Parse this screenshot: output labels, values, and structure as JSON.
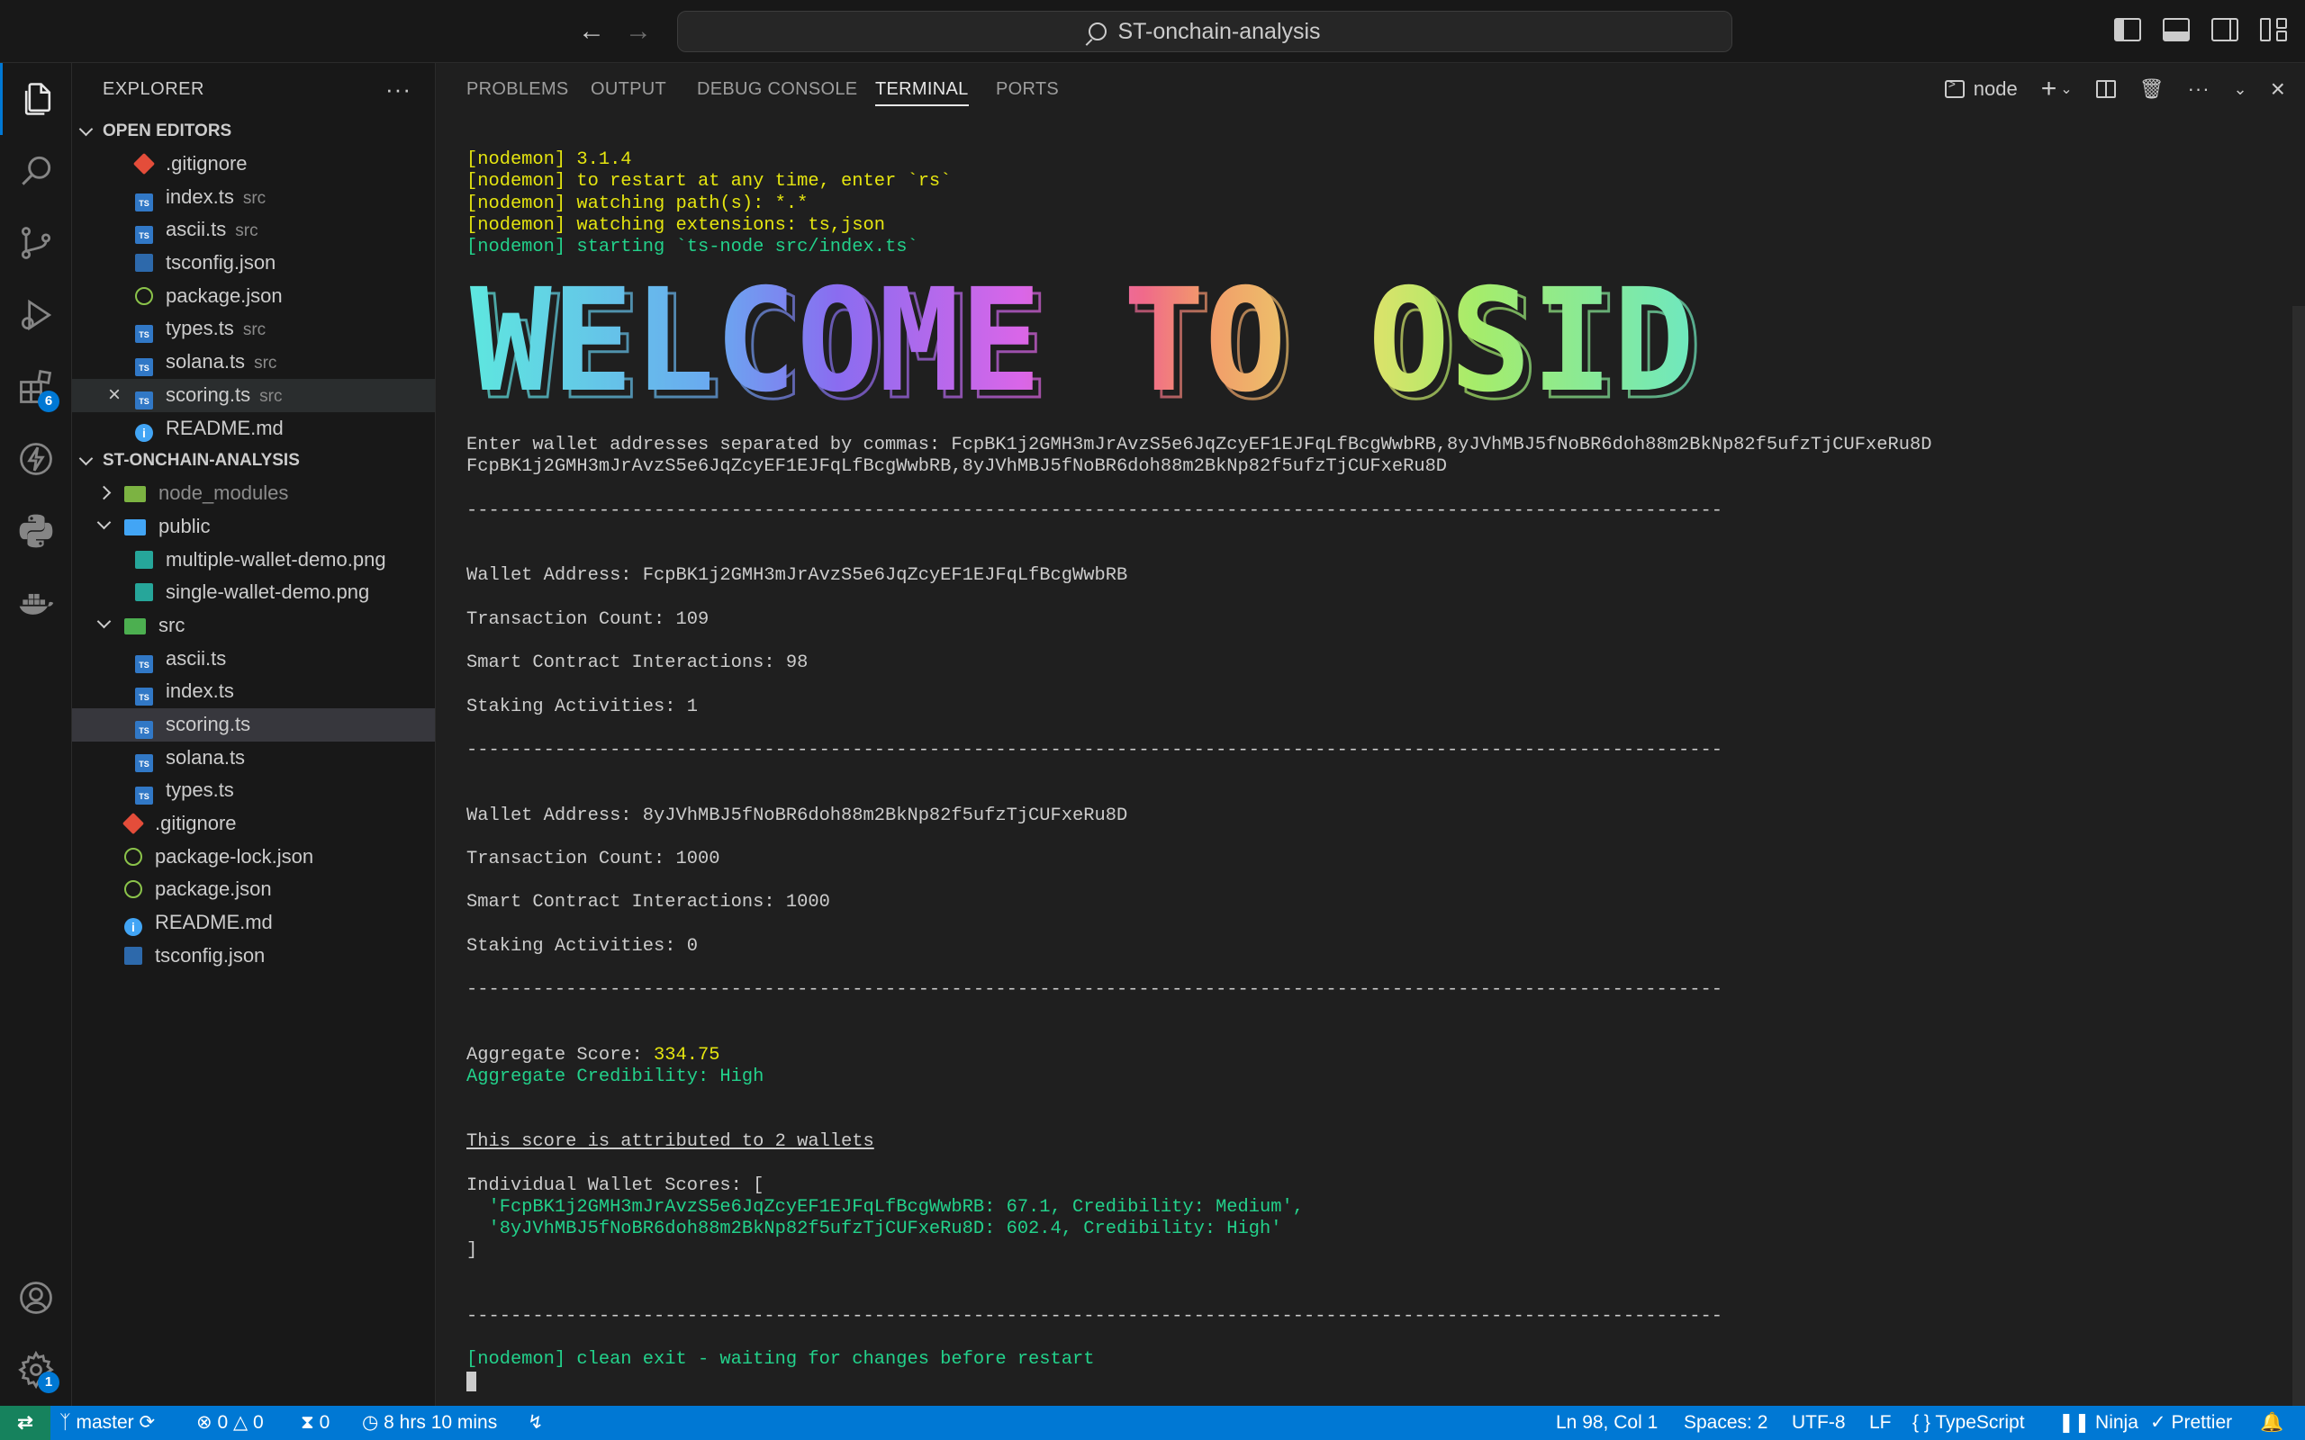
{
  "titlebar": {
    "search_text": "ST-onchain-analysis",
    "back_icon": "arrow-left-icon",
    "forward_icon": "arrow-right-icon"
  },
  "activitybar": {
    "extensions_badge": "6",
    "settings_badge": "1"
  },
  "explorer": {
    "title": "EXPLORER",
    "open_editors_label": "OPEN EDITORS",
    "open_editors": [
      {
        "name": ".gitignore",
        "desc": ""
      },
      {
        "name": "index.ts",
        "desc": "src"
      },
      {
        "name": "ascii.ts",
        "desc": "src"
      },
      {
        "name": "tsconfig.json",
        "desc": ""
      },
      {
        "name": "package.json",
        "desc": ""
      },
      {
        "name": "types.ts",
        "desc": "src"
      },
      {
        "name": "solana.ts",
        "desc": "src"
      },
      {
        "name": "scoring.ts",
        "desc": "src"
      },
      {
        "name": "README.md",
        "desc": ""
      }
    ],
    "project_label": "ST-ONCHAIN-ANALYSIS",
    "tree": {
      "node_modules": "node_modules",
      "public": "public",
      "public_files": [
        "multiple-wallet-demo.png",
        "single-wallet-demo.png"
      ],
      "src": "src",
      "src_files": [
        "ascii.ts",
        "index.ts",
        "scoring.ts",
        "solana.ts",
        "types.ts"
      ],
      "root_files": [
        ".gitignore",
        "package-lock.json",
        "package.json",
        "README.md",
        "tsconfig.json"
      ]
    }
  },
  "panel": {
    "tabs": [
      "PROBLEMS",
      "OUTPUT",
      "DEBUG CONSOLE",
      "TERMINAL",
      "PORTS"
    ],
    "terminal_name": "node"
  },
  "terminal": {
    "nodemon": [
      "[nodemon] 3.1.4",
      "[nodemon] to restart at any time, enter `rs`",
      "[nodemon] watching path(s): *.*",
      "[nodemon] watching extensions: ts,json"
    ],
    "nodemon_start": "[nodemon] starting `ts-node src/index.ts`",
    "banner_text": "WELCOME TO OSID",
    "prompt": "Enter wallet addresses separated by commas: FcpBK1j2GMH3mJrAvzS5e6JqZcyEF1EJFqLfBcgWwbRB,8yJVhMBJ5fNoBR6doh88m2BkNp82f5ufzTjCUFxeRu8D",
    "echo": "FcpBK1j2GMH3mJrAvzS5e6JqZcyEF1EJFqLfBcgWwbRB,8yJVhMBJ5fNoBR6doh88m2BkNp82f5ufzTjCUFxeRu8D",
    "divider": "------------------------------------------------------------------------------------------------------------------",
    "wallets": [
      {
        "address_line": "Wallet Address: FcpBK1j2GMH3mJrAvzS5e6JqZcyEF1EJFqLfBcgWwbRB",
        "tx_line": "Transaction Count: 109",
        "sc_line": "Smart Contract Interactions: 98",
        "stake_line": "Staking Activities: 1"
      },
      {
        "address_line": "Wallet Address: 8yJVhMBJ5fNoBR6doh88m2BkNp82f5ufzTjCUFxeRu8D",
        "tx_line": "Transaction Count: 1000",
        "sc_line": "Smart Contract Interactions: 1000",
        "stake_line": "Staking Activities: 0"
      }
    ],
    "aggregate_label": "Aggregate Score: ",
    "aggregate_value": "334.75",
    "credibility_line": "Aggregate Credibility: High",
    "attributed_line": "This score is attributed to 2 wallets",
    "individual_open": "Individual Wallet Scores: [",
    "individual_scores": [
      "  'FcpBK1j2GMH3mJrAvzS5e6JqZcyEF1EJFqLfBcgWwbRB: 67.1, Credibility: Medium',",
      "  '8yJVhMBJ5fNoBR6doh88m2BkNp82f5ufzTjCUFxeRu8D: 602.4, Credibility: High'"
    ],
    "individual_close": "]",
    "exit_line": "[nodemon] clean exit - waiting for changes before restart"
  },
  "statusbar": {
    "branch": "master",
    "errors": "0",
    "warnings": "0",
    "ports": "0",
    "time": "8 hrs 10 mins",
    "position": "Ln 98, Col 1",
    "spaces": "Spaces: 2",
    "encoding": "UTF-8",
    "eol": "LF",
    "language": "TypeScript",
    "ninja": "Ninja",
    "prettier": "Prettier"
  },
  "colors": {
    "accent": "#0078d4",
    "terminal_yellow": "#e5e510",
    "terminal_green": "#23d18b"
  }
}
